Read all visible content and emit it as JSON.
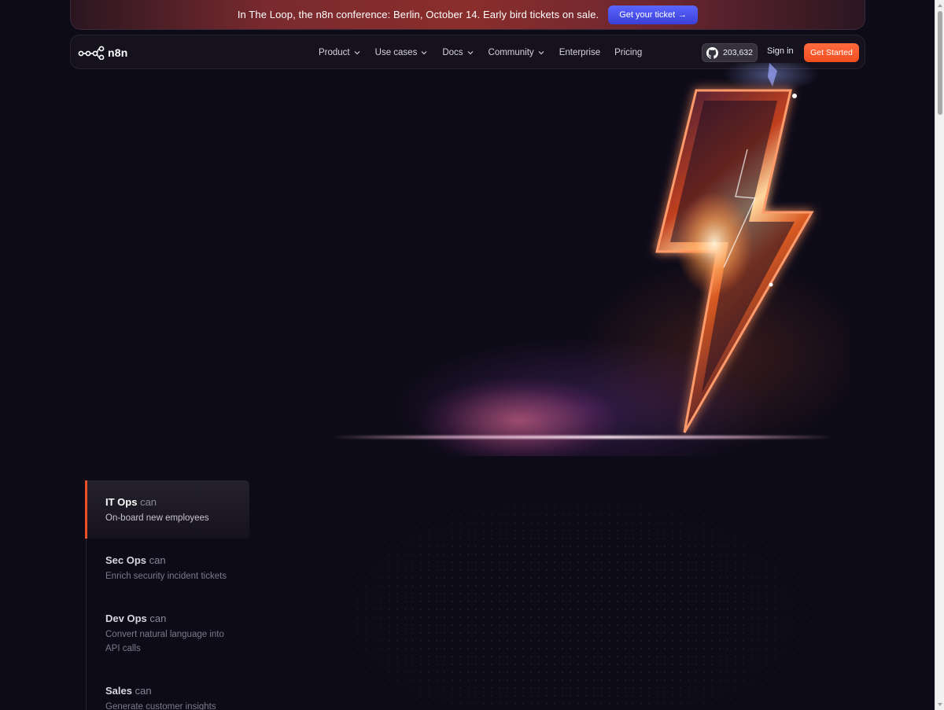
{
  "banner": {
    "text": "In The Loop, the n8n conference: Berlin, October 14. Early bird tickets on sale.",
    "cta_label": "Get your ticket",
    "cta_arrow": "→"
  },
  "nav": {
    "logo_text": "n8n",
    "links": [
      {
        "label": "Product",
        "has_dropdown": true
      },
      {
        "label": "Use cases",
        "has_dropdown": true
      },
      {
        "label": "Docs",
        "has_dropdown": true
      },
      {
        "label": "Community",
        "has_dropdown": true
      },
      {
        "label": "Enterprise",
        "has_dropdown": false
      },
      {
        "label": "Pricing",
        "has_dropdown": false
      }
    ],
    "github_stars": "203,632",
    "signin_label": "Sign in",
    "get_started_label": "Get Started"
  },
  "use_cases": [
    {
      "role": "IT Ops",
      "can": "can",
      "desc": "On-board new employees",
      "active": true
    },
    {
      "role": "Sec Ops",
      "can": "can",
      "desc": "Enrich security incident tickets",
      "active": false
    },
    {
      "role": "Dev Ops",
      "can": "can",
      "desc": "Convert natural language into API calls",
      "active": false
    },
    {
      "role": "Sales",
      "can": "can",
      "desc": "Generate customer insights",
      "active": false
    }
  ],
  "colors": {
    "background": "#0e0b18",
    "accent_orange": "#f24e21",
    "ticket_blue": "#4a52f0",
    "active_marker": "#ee4f27"
  },
  "icons": {
    "logo": "n8n-nodes-icon",
    "github": "github-icon",
    "chevron": "chevron-down-icon",
    "hero": "lightning-bolt-icon"
  }
}
